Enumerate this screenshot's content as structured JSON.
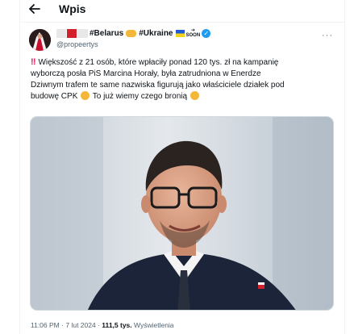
{
  "header": {
    "title": "Wpis",
    "back_icon": "arrow-left-icon"
  },
  "author": {
    "display_name_text": "#Belarus",
    "display_name_text2": "#Ukraine",
    "soon_label": "SOON",
    "handle": "@propeertys",
    "verified_icon": "verified-badge-icon",
    "more_icon": "more-horizontal-icon",
    "flag_colors": [
      "#e8e8e8",
      "#d3202a",
      "#e8e8e8"
    ]
  },
  "tweet": {
    "lines": [
      "Większość z 21 osób, które wpłaciły ponad 120 tys. zł na kampanię",
      "wyborczą posła PiS Marcina Horały, była zatrudniona w Enerdze",
      "Dziwnym trafem te same nazwiska figurują jako właściciele działek pod",
      "budowę CPK",
      "To już wiemy czego bronią"
    ]
  },
  "meta": {
    "time": "11:06 PM",
    "date": "7 lut 2024",
    "views_count": "111,5 tys.",
    "views_label": "Wyświetlenia",
    "separator": "·"
  },
  "colors": {
    "accent": "#1d9bf0",
    "text": "#0f1419",
    "secondary": "#536471",
    "alert": "#e0245e"
  }
}
